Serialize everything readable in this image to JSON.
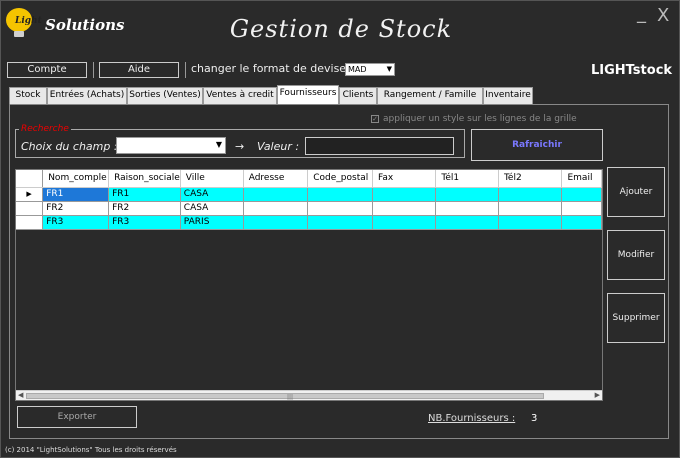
{
  "logo": {
    "light": "Light",
    "solutions": "Solutions"
  },
  "window": {
    "title": "Gestion de Stock",
    "minimize": "_",
    "close": "X"
  },
  "toolbar": {
    "compte_label": "Compte",
    "aide_label": "Aide",
    "devise_label": "changer le format de devise :",
    "devise_value": "MAD",
    "brand": "LIGHTstock"
  },
  "tabs": [
    {
      "label": "Stock"
    },
    {
      "label": "Entrées (Achats)"
    },
    {
      "label": "Sorties (Ventes)"
    },
    {
      "label": "Ventes à credit"
    },
    {
      "label": "Fournisseurs",
      "active": true
    },
    {
      "label": "Clients"
    },
    {
      "label": "Rangement / Famille"
    },
    {
      "label": "Inventaire"
    }
  ],
  "options": {
    "style_checkbox_label": "appliquer un style sur les lignes de la grille",
    "style_checkbox_checked": true
  },
  "search": {
    "legend": "Recherche",
    "champ_label": "Choix du champ :",
    "champ_value": "",
    "arrow": "→",
    "valeur_label": "Valeur :",
    "valeur_value": "",
    "refresh_label": "Rafraichir"
  },
  "grid": {
    "columns": [
      "Nom_comple",
      "Raison_sociale",
      "Ville",
      "Adresse",
      "Code_postal",
      "Fax",
      "Tél1",
      "Tél2",
      "Email"
    ],
    "rows": [
      {
        "cells": [
          "FR1",
          "FR1",
          "CASA",
          "",
          "",
          "",
          "",
          "",
          ""
        ],
        "style": "cyan",
        "current": true
      },
      {
        "cells": [
          "FR2",
          "FR2",
          "CASA",
          "",
          "",
          "",
          "",
          "",
          ""
        ],
        "style": "white",
        "current": false
      },
      {
        "cells": [
          "FR3",
          "FR3",
          "PARIS",
          "",
          "",
          "",
          "",
          "",
          ""
        ],
        "style": "cyan",
        "current": false
      }
    ]
  },
  "actions": {
    "ajouter": "Ajouter",
    "modifier": "Modifier",
    "supprimer": "Supprimer"
  },
  "bottom": {
    "export_label": "Exporter",
    "nb_label": "NB.Fournisseurs :",
    "nb_value": "3"
  },
  "footer": {
    "copyright": "(c) 2014 \"LightSolutions\" Tous les droits réservés"
  },
  "colors": {
    "accent_cyan": "#00ffff",
    "selection_blue": "#1e78d8",
    "refresh_text": "#7a78ff",
    "legend_red": "#ee0000"
  }
}
